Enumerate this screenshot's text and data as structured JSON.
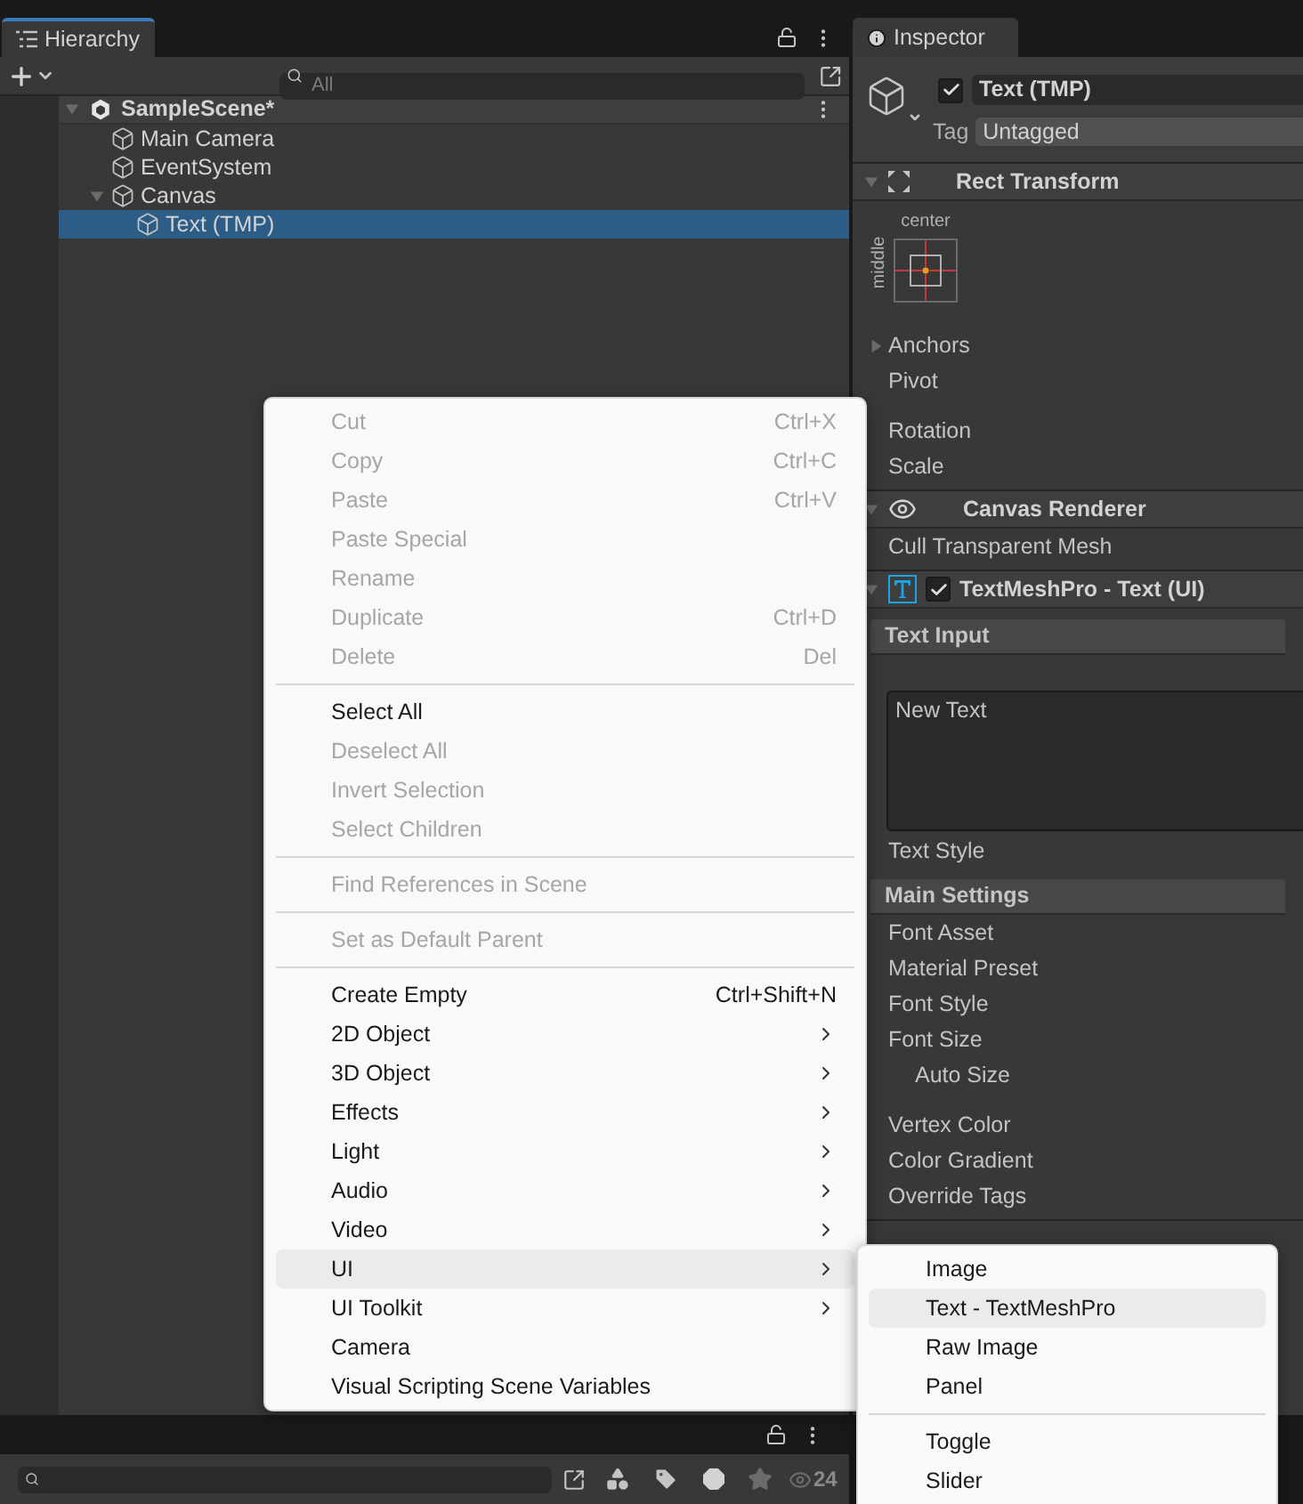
{
  "hierarchy": {
    "tab": "Hierarchy",
    "search_placeholder": "All",
    "scene": {
      "name": "SampleScene*",
      "expanded": true,
      "children": [
        {
          "name": "Main Camera",
          "selected": false
        },
        {
          "name": "EventSystem",
          "selected": false
        },
        {
          "name": "Canvas",
          "selected": false,
          "expanded": true,
          "children": [
            {
              "name": "Text (TMP)",
              "selected": true
            }
          ]
        }
      ]
    }
  },
  "inspector": {
    "tab": "Inspector",
    "object_name": "Text (TMP)",
    "active": true,
    "tag_label": "Tag",
    "tag_value": "Untagged",
    "components": [
      {
        "title": "Rect Transform",
        "expanded": true,
        "anchor": {
          "horizontal": "center",
          "vertical": "middle"
        },
        "rows": [
          {
            "kind": "foldout",
            "label": "Anchors",
            "expanded": false
          },
          {
            "kind": "field",
            "label": "Pivot"
          },
          {
            "kind": "gap"
          },
          {
            "kind": "field",
            "label": "Rotation"
          },
          {
            "kind": "field",
            "label": "Scale"
          }
        ]
      },
      {
        "title": "Canvas Renderer",
        "expanded": true,
        "rows": [
          {
            "kind": "field",
            "label": "Cull Transparent Mesh"
          }
        ]
      },
      {
        "title": "TextMeshPro - Text (UI)",
        "enabled": true,
        "expanded": true,
        "rows": [
          {
            "kind": "section",
            "label": "Text Input"
          },
          {
            "kind": "textarea",
            "value": "New Text"
          },
          {
            "kind": "field",
            "label": "Text Style"
          },
          {
            "kind": "section",
            "label": "Main Settings"
          },
          {
            "kind": "field",
            "label": "Font Asset"
          },
          {
            "kind": "field",
            "label": "Material Preset"
          },
          {
            "kind": "field",
            "label": "Font Style"
          },
          {
            "kind": "field",
            "label": "Font Size"
          },
          {
            "kind": "subfield",
            "label": "Auto Size"
          },
          {
            "kind": "gap"
          },
          {
            "kind": "field",
            "label": "Vertex Color"
          },
          {
            "kind": "field",
            "label": "Color Gradient"
          },
          {
            "kind": "field",
            "label": "Override Tags"
          }
        ]
      }
    ]
  },
  "context_menu": [
    {
      "kind": "item",
      "label": "Cut",
      "shortcut": "Ctrl+X",
      "disabled": true,
      "submenu": false,
      "selected": false
    },
    {
      "kind": "item",
      "label": "Copy",
      "shortcut": "Ctrl+C",
      "disabled": true,
      "submenu": false,
      "selected": false
    },
    {
      "kind": "item",
      "label": "Paste",
      "shortcut": "Ctrl+V",
      "disabled": true,
      "submenu": false,
      "selected": false
    },
    {
      "kind": "item",
      "label": "Paste Special",
      "disabled": true,
      "submenu": false,
      "selected": false
    },
    {
      "kind": "item",
      "label": "Rename",
      "disabled": true,
      "submenu": false,
      "selected": false
    },
    {
      "kind": "item",
      "label": "Duplicate",
      "shortcut": "Ctrl+D",
      "disabled": true,
      "submenu": false,
      "selected": false
    },
    {
      "kind": "item",
      "label": "Delete",
      "shortcut": "Del",
      "disabled": true,
      "submenu": false,
      "selected": false
    },
    {
      "kind": "separator"
    },
    {
      "kind": "item",
      "label": "Select All",
      "disabled": false,
      "submenu": false,
      "selected": false
    },
    {
      "kind": "item",
      "label": "Deselect All",
      "disabled": true,
      "submenu": false,
      "selected": false
    },
    {
      "kind": "item",
      "label": "Invert Selection",
      "disabled": true,
      "submenu": false,
      "selected": false
    },
    {
      "kind": "item",
      "label": "Select Children",
      "disabled": true,
      "submenu": false,
      "selected": false
    },
    {
      "kind": "separator"
    },
    {
      "kind": "item",
      "label": "Find References in Scene",
      "disabled": true,
      "submenu": false,
      "selected": false
    },
    {
      "kind": "separator"
    },
    {
      "kind": "item",
      "label": "Set as Default Parent",
      "disabled": true,
      "submenu": false,
      "selected": false
    },
    {
      "kind": "separator"
    },
    {
      "kind": "item",
      "label": "Create Empty",
      "shortcut": "Ctrl+Shift+N",
      "disabled": false,
      "submenu": false,
      "selected": false
    },
    {
      "kind": "item",
      "label": "2D Object",
      "disabled": false,
      "submenu": true,
      "selected": false
    },
    {
      "kind": "item",
      "label": "3D Object",
      "disabled": false,
      "submenu": true,
      "selected": false
    },
    {
      "kind": "item",
      "label": "Effects",
      "disabled": false,
      "submenu": true,
      "selected": false
    },
    {
      "kind": "item",
      "label": "Light",
      "disabled": false,
      "submenu": true,
      "selected": false
    },
    {
      "kind": "item",
      "label": "Audio",
      "disabled": false,
      "submenu": true,
      "selected": false
    },
    {
      "kind": "item",
      "label": "Video",
      "disabled": false,
      "submenu": true,
      "selected": false
    },
    {
      "kind": "item",
      "label": "UI",
      "disabled": false,
      "submenu": true,
      "selected": true
    },
    {
      "kind": "item",
      "label": "UI Toolkit",
      "disabled": false,
      "submenu": true,
      "selected": false
    },
    {
      "kind": "item",
      "label": "Camera",
      "disabled": false,
      "submenu": false,
      "selected": false
    },
    {
      "kind": "item",
      "label": "Visual Scripting Scene Variables",
      "disabled": false,
      "submenu": false,
      "selected": false
    }
  ],
  "submenu": [
    {
      "kind": "item",
      "label": "Image",
      "selected": false
    },
    {
      "kind": "item",
      "label": "Text - TextMeshPro",
      "selected": true
    },
    {
      "kind": "item",
      "label": "Raw Image",
      "selected": false
    },
    {
      "kind": "item",
      "label": "Panel",
      "selected": false
    },
    {
      "kind": "separator"
    },
    {
      "kind": "item",
      "label": "Toggle",
      "selected": false
    },
    {
      "kind": "item",
      "label": "Slider",
      "selected": false
    }
  ],
  "project": {
    "visible_count": "24"
  }
}
